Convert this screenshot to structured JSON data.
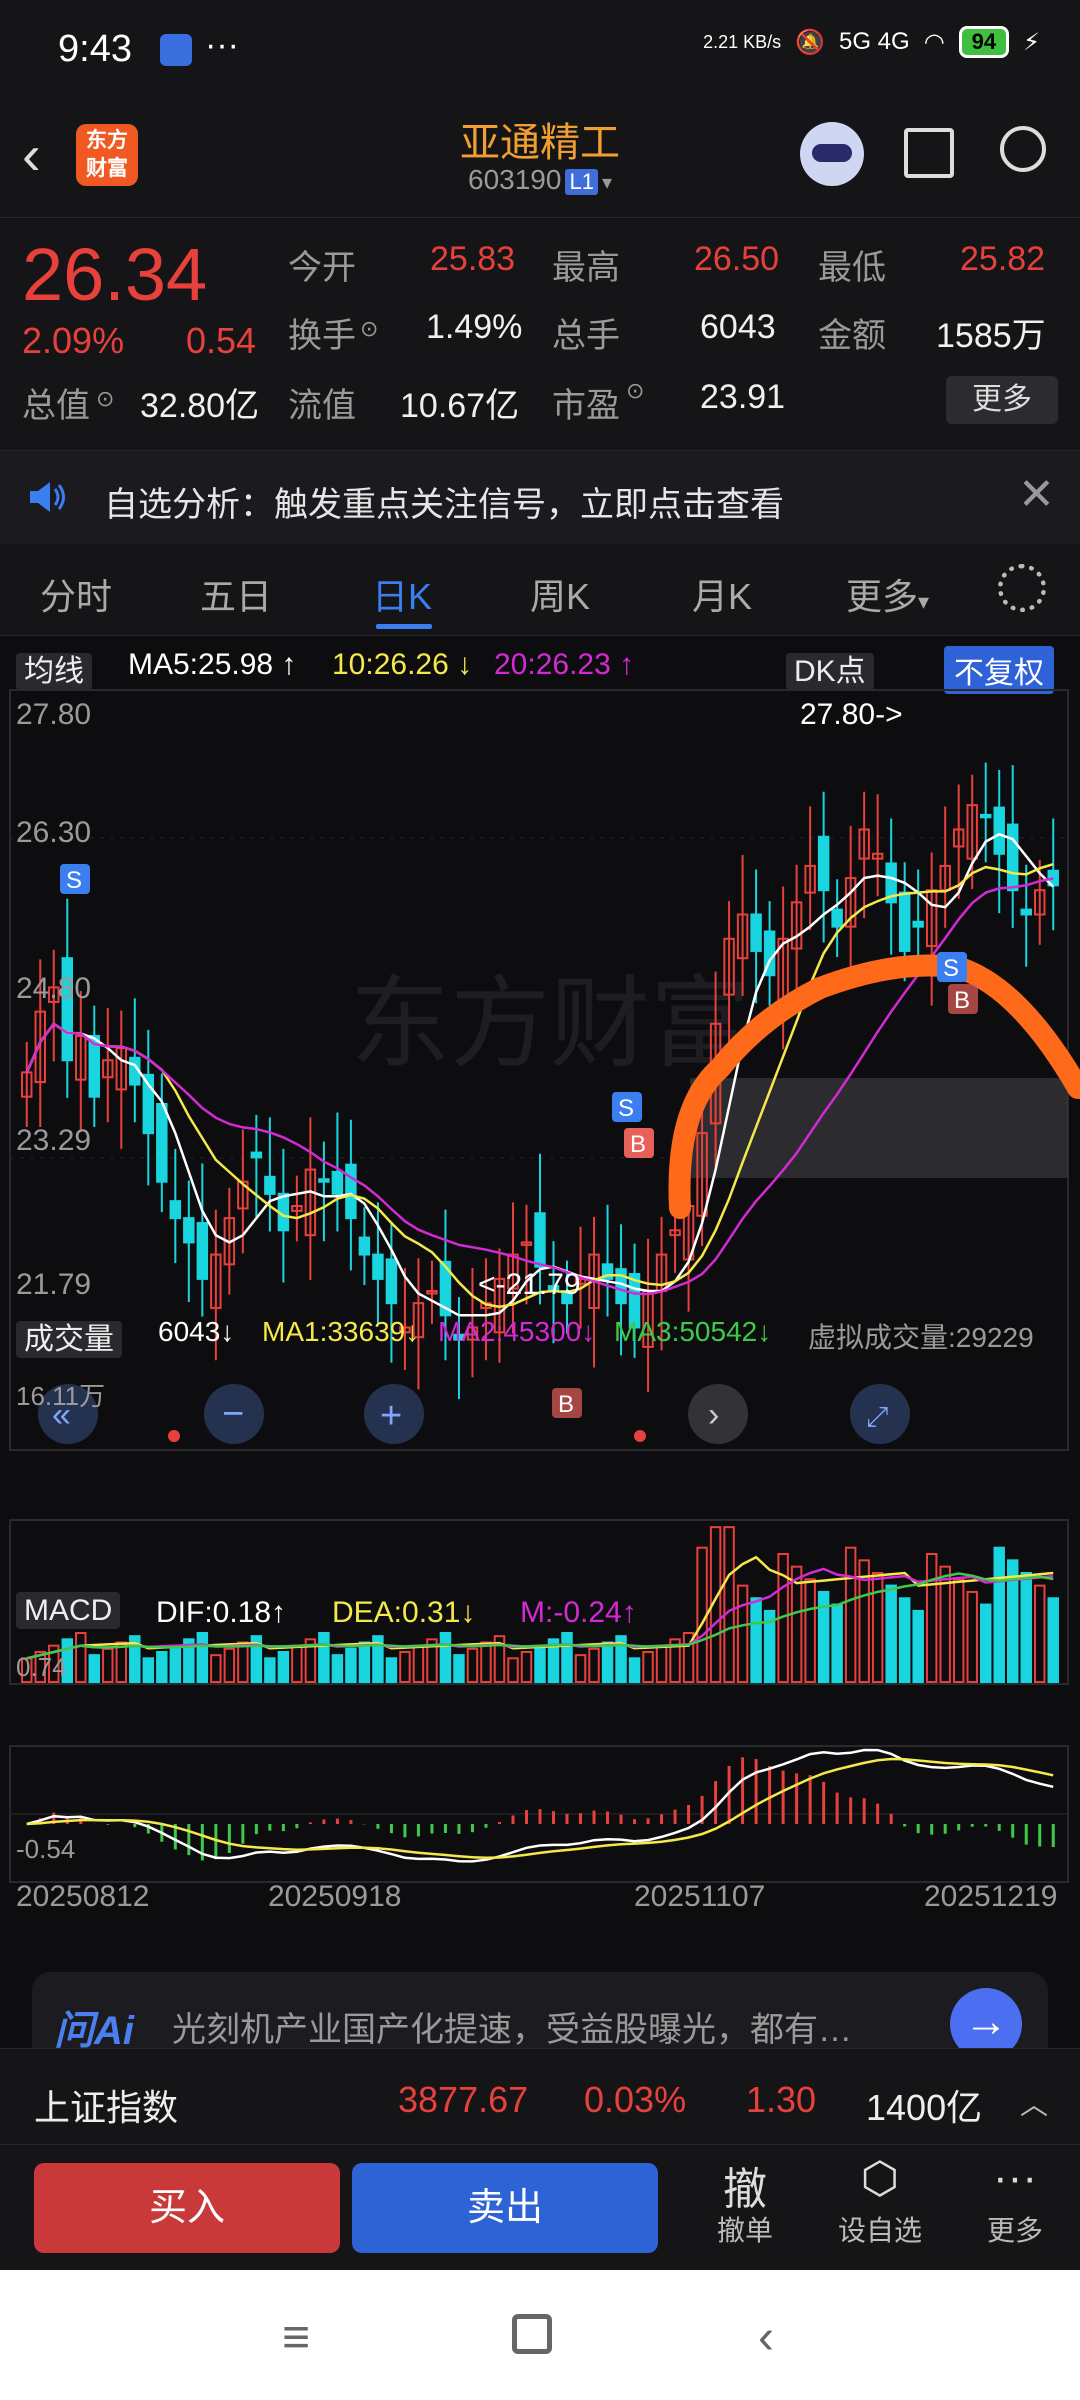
{
  "status": {
    "time": "9:43",
    "net_speed": "2.21 KB/s",
    "signal": "5G  4G",
    "battery": "94"
  },
  "header": {
    "back_icon": "back-chevron-icon",
    "logo": "东方财富",
    "name": "亚通精工",
    "code": "603190",
    "level": "L1"
  },
  "quote": {
    "price": "26.34",
    "pct": "2.09%",
    "change": "0.54",
    "fields": [
      {
        "label": "今开",
        "value": "25.83",
        "color": "#e8413b"
      },
      {
        "label": "最高",
        "value": "26.50",
        "color": "#e8413b"
      },
      {
        "label": "最低",
        "value": "25.82",
        "color": "#e8413b"
      },
      {
        "label": "换手",
        "value": "1.49%",
        "color": "#f0f0f0"
      },
      {
        "label": "总手",
        "value": "6043",
        "color": "#f0f0f0"
      },
      {
        "label": "金额",
        "value": "1585万",
        "color": "#f0f0f0"
      },
      {
        "label": "总值",
        "value": "32.80亿",
        "color": "#f0f0f0"
      },
      {
        "label": "流值",
        "value": "10.67亿",
        "color": "#f0f0f0"
      },
      {
        "label": "市盈",
        "value": "23.91",
        "color": "#f0f0f0"
      }
    ],
    "more": "更多"
  },
  "notice": {
    "text": "自选分析：触发重点关注信号，立即点击查看"
  },
  "tabs": [
    "分时",
    "五日",
    "日K",
    "周K",
    "月K",
    "更多"
  ],
  "active_tab": 2,
  "kline": {
    "ma_select": "均线",
    "ma5": "MA5:25.98 ↑",
    "ma10": "10:26.26 ↓",
    "ma20": "20:26.23 ↑",
    "dk_label": "DK点",
    "fq_label": "不复权",
    "y_top": "27.80",
    "y2": "26.30",
    "y3": "23.29",
    "y_bottom": "21.79",
    "y_mid": "24.80",
    "high_mark": "27.80->",
    "low_mark": "<-21.79"
  },
  "volume": {
    "select": "成交量",
    "vol": "6043↓",
    "ma1": "MA1:33639↓",
    "ma2": "MA2:45300↓",
    "ma3": "MA3:50542↓",
    "virtual": "虚拟成交量:29229",
    "y_top": "16.11万"
  },
  "macd": {
    "select": "MACD",
    "dif": "DIF:0.18↑",
    "dea": "DEA:0.31↓",
    "m": "M:-0.24↑",
    "y_top": "0.74",
    "y_bottom": "-0.54"
  },
  "dates": [
    "20250812",
    "20250918",
    "20251107",
    "20251219"
  ],
  "ai": {
    "logo": "问Ai",
    "text": "光刻机产业国产化提速，受益股曝光，都有…"
  },
  "index": {
    "name": "上证指数",
    "value": "3877.67",
    "pct": "0.03%",
    "chg": "1.30",
    "amount": "1400亿"
  },
  "trade": {
    "buy": "买入",
    "sell": "卖出",
    "cancel": "撤单",
    "cancel_icon": "撤",
    "watch": "设自选",
    "more": "更多"
  },
  "colors": {
    "up": "#e8413b",
    "down": "#19d5e0",
    "ma5": "#ffffff",
    "ma10": "#f5e84a",
    "ma20": "#d42ad4",
    "accent": "#3b7ef0"
  },
  "chart_data": {
    "type": "candlestick",
    "title": "亚通精工 603190 日K",
    "x_labels": [
      "20250812",
      "20250918",
      "20251107",
      "20251219"
    ],
    "ylim": [
      21.79,
      27.8
    ],
    "close_approx": [
      24.8,
      25.3,
      25.5,
      24.9,
      25.1,
      24.6,
      24.9,
      25.0,
      24.7,
      24.3,
      23.9,
      23.6,
      23.4,
      23.1,
      23.3,
      23.6,
      23.9,
      24.1,
      23.8,
      23.5,
      23.7,
      24.0,
      23.9,
      23.8,
      23.6,
      23.3,
      23.1,
      22.9,
      22.7,
      22.9,
      23.0,
      22.8,
      22.6,
      22.7,
      22.9,
      23.1,
      23.3,
      23.4,
      23.2,
      23.0,
      22.9,
      23.1,
      23.3,
      23.1,
      22.9,
      22.7,
      23.0,
      23.3,
      23.5,
      23.7,
      24.3,
      25.2,
      25.9,
      26.1,
      25.8,
      25.6,
      25.9,
      26.2,
      26.5,
      26.3,
      26.0,
      26.4,
      26.8,
      26.6,
      26.2,
      25.8,
      26.0,
      26.3,
      26.5,
      26.8,
      27.0,
      26.9,
      26.6,
      26.3,
      26.1,
      26.3,
      26.34
    ],
    "series": [
      {
        "name": "MA5",
        "last": 25.98
      },
      {
        "name": "MA10",
        "last": 26.26
      },
      {
        "name": "MA20",
        "last": 26.23
      }
    ],
    "volume_ylim_top": "16.11万",
    "macd": {
      "dif": 0.18,
      "dea": 0.31,
      "m": -0.24,
      "ylim": [
        -0.54,
        0.74
      ]
    }
  }
}
